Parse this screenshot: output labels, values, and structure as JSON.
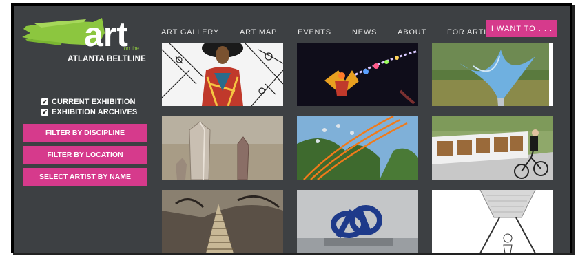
{
  "logo": {
    "word": "art",
    "on_the": "on the",
    "subtitle": "ATLANTA BELTLINE"
  },
  "nav": {
    "items": [
      "ART GALLERY",
      "ART MAP",
      "EVENTS",
      "NEWS",
      "ABOUT",
      "FOR ARTISTS"
    ],
    "cta": "I WANT TO . . ."
  },
  "filters": {
    "checkboxes": [
      {
        "label": "CURRENT EXHIBITION",
        "checked": true
      },
      {
        "label": "EXHIBITION ARCHIVES",
        "checked": true
      }
    ],
    "buttons": [
      "FILTER BY DISCIPLINE",
      "FILTER BY LOCATION",
      "SELECT ARTIST BY NAME"
    ]
  },
  "gallery": {
    "tiles": [
      {
        "subject": "portrait-collage"
      },
      {
        "subject": "lantern-night"
      },
      {
        "subject": "metal-sculpture"
      },
      {
        "subject": "crystals"
      },
      {
        "subject": "orange-lines-sky"
      },
      {
        "subject": "cyclist-mural"
      },
      {
        "subject": "woven-cone"
      },
      {
        "subject": "blue-knot"
      },
      {
        "subject": "swing-sketch"
      }
    ]
  },
  "colors": {
    "background": "#3d4043",
    "accent": "#d63a8c",
    "brand_green": "#8cc63f"
  }
}
